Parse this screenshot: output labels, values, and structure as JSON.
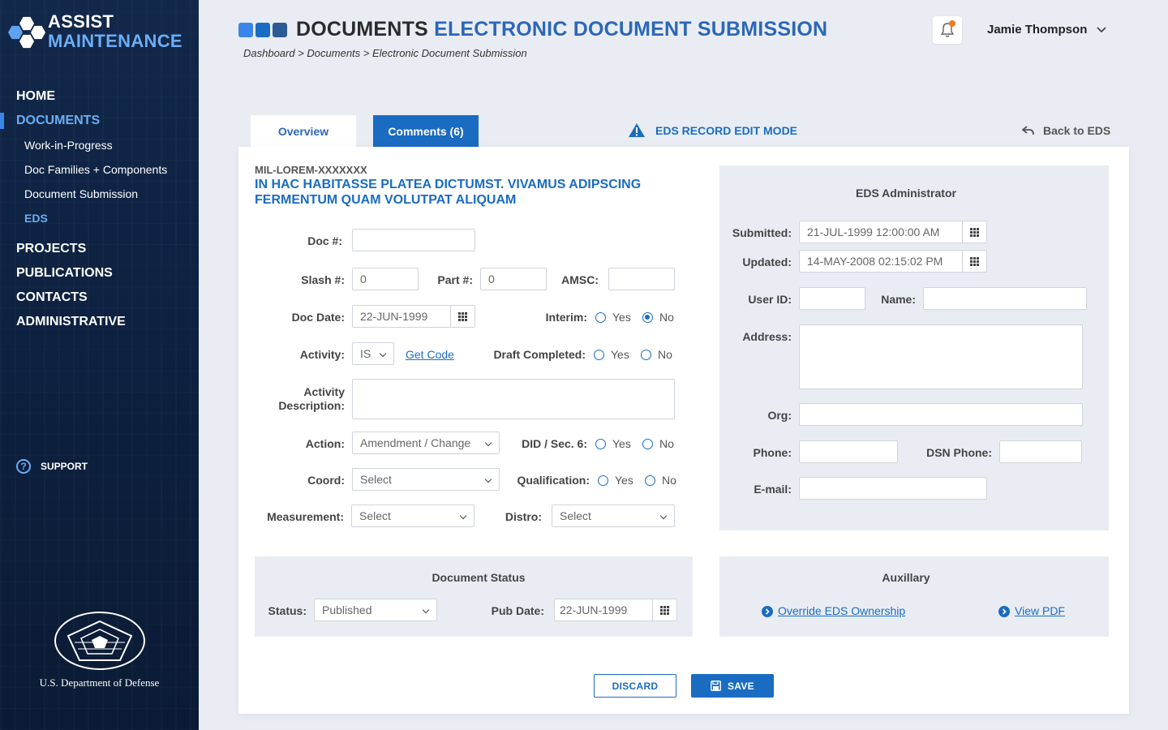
{
  "app": {
    "name_line1": "ASSIST",
    "name_line2": "MAINTENANCE"
  },
  "nav": {
    "home": "HOME",
    "documents": "DOCUMENTS",
    "documents_sub": [
      "Work-in-Progress",
      "Doc Families + Components",
      "Document Submission",
      "EDS"
    ],
    "projects": "PROJECTS",
    "publications": "PUBLICATIONS",
    "contacts": "CONTACTS",
    "administrative": "ADMINISTRATIVE",
    "support": "SUPPORT"
  },
  "dod": {
    "caption": "U.S. Department of Defense"
  },
  "header": {
    "title_dark": "DOCUMENTS",
    "title_blue": "ELECTRONIC DOCUMENT SUBMISSION",
    "square_colors": [
      "#3a86e8",
      "#1a6cc2",
      "#2c5a96"
    ],
    "breadcrumb": "Dashboard > Documents > Electronic Document Submission"
  },
  "user": {
    "name": "Jamie Thompson",
    "notification_dot_color": "#f07b22"
  },
  "tabs": {
    "overview": "Overview",
    "comments": "Comments (6)"
  },
  "edit_mode": {
    "label": "EDS RECORD EDIT MODE"
  },
  "back": {
    "label": "Back to EDS"
  },
  "document": {
    "id": "MIL-LOREM-XXXXXXX",
    "title": "IN HAC HABITASSE PLATEA DICTUMST. VIVAMUS ADIPSCING FERMENTUM QUAM VOLUTPAT ALIQUAM"
  },
  "form": {
    "doc_num": {
      "label": "Doc #:",
      "value": ""
    },
    "slash_num": {
      "label": "Slash #:",
      "value": "0"
    },
    "part_num": {
      "label": "Part #:",
      "value": "0"
    },
    "amsc": {
      "label": "AMSC:",
      "value": ""
    },
    "doc_date": {
      "label": "Doc Date:",
      "value": "22-JUN-1999"
    },
    "interim": {
      "label": "Interim:",
      "yes": "Yes",
      "no": "No",
      "selected": "No"
    },
    "activity": {
      "label": "Activity:",
      "value": "IS",
      "get_code": "Get Code"
    },
    "draft_completed": {
      "label": "Draft Completed:",
      "yes": "Yes",
      "no": "No",
      "selected": ""
    },
    "activity_description": {
      "label_line1": "Activity",
      "label_line2": "Description:",
      "value": ""
    },
    "action": {
      "label": "Action:",
      "value": "Amendment / Change"
    },
    "did_sec6": {
      "label": "DID / Sec. 6:",
      "yes": "Yes",
      "no": "No",
      "selected": ""
    },
    "coord": {
      "label": "Coord:",
      "value": "Select"
    },
    "qualification": {
      "label": "Qualification:",
      "yes": "Yes",
      "no": "No",
      "selected": ""
    },
    "measurement": {
      "label": "Measurement:",
      "value": "Select"
    },
    "distro": {
      "label": "Distro:",
      "value": "Select"
    }
  },
  "eds_admin": {
    "title": "EDS Administrator",
    "submitted": {
      "label": "Submitted:",
      "value": "21-JUL-1999 12:00:00 AM"
    },
    "updated": {
      "label": "Updated:",
      "value": "14-MAY-2008 02:15:02 PM"
    },
    "user_id": {
      "label": "User ID:",
      "value": ""
    },
    "name": {
      "label": "Name:",
      "value": ""
    },
    "address": {
      "label": "Address:",
      "value": ""
    },
    "org": {
      "label": "Org:",
      "value": ""
    },
    "phone": {
      "label": "Phone:",
      "value": ""
    },
    "dsn_phone": {
      "label": "DSN Phone:",
      "value": ""
    },
    "email": {
      "label": "E-mail:",
      "value": ""
    }
  },
  "document_status": {
    "title": "Document Status",
    "status": {
      "label": "Status:",
      "value": "Published"
    },
    "pub_date": {
      "label": "Pub Date:",
      "value": "22-JUN-1999"
    }
  },
  "auxiliary": {
    "title": "Auxillary",
    "override": "Override EDS Ownership",
    "view_pdf": "View PDF"
  },
  "actions": {
    "discard": "DISCARD",
    "save": "SAVE"
  },
  "colors": {
    "accent": "#1a6cc2",
    "sidebar": "#0d2140",
    "panel": "#e9edf3"
  }
}
